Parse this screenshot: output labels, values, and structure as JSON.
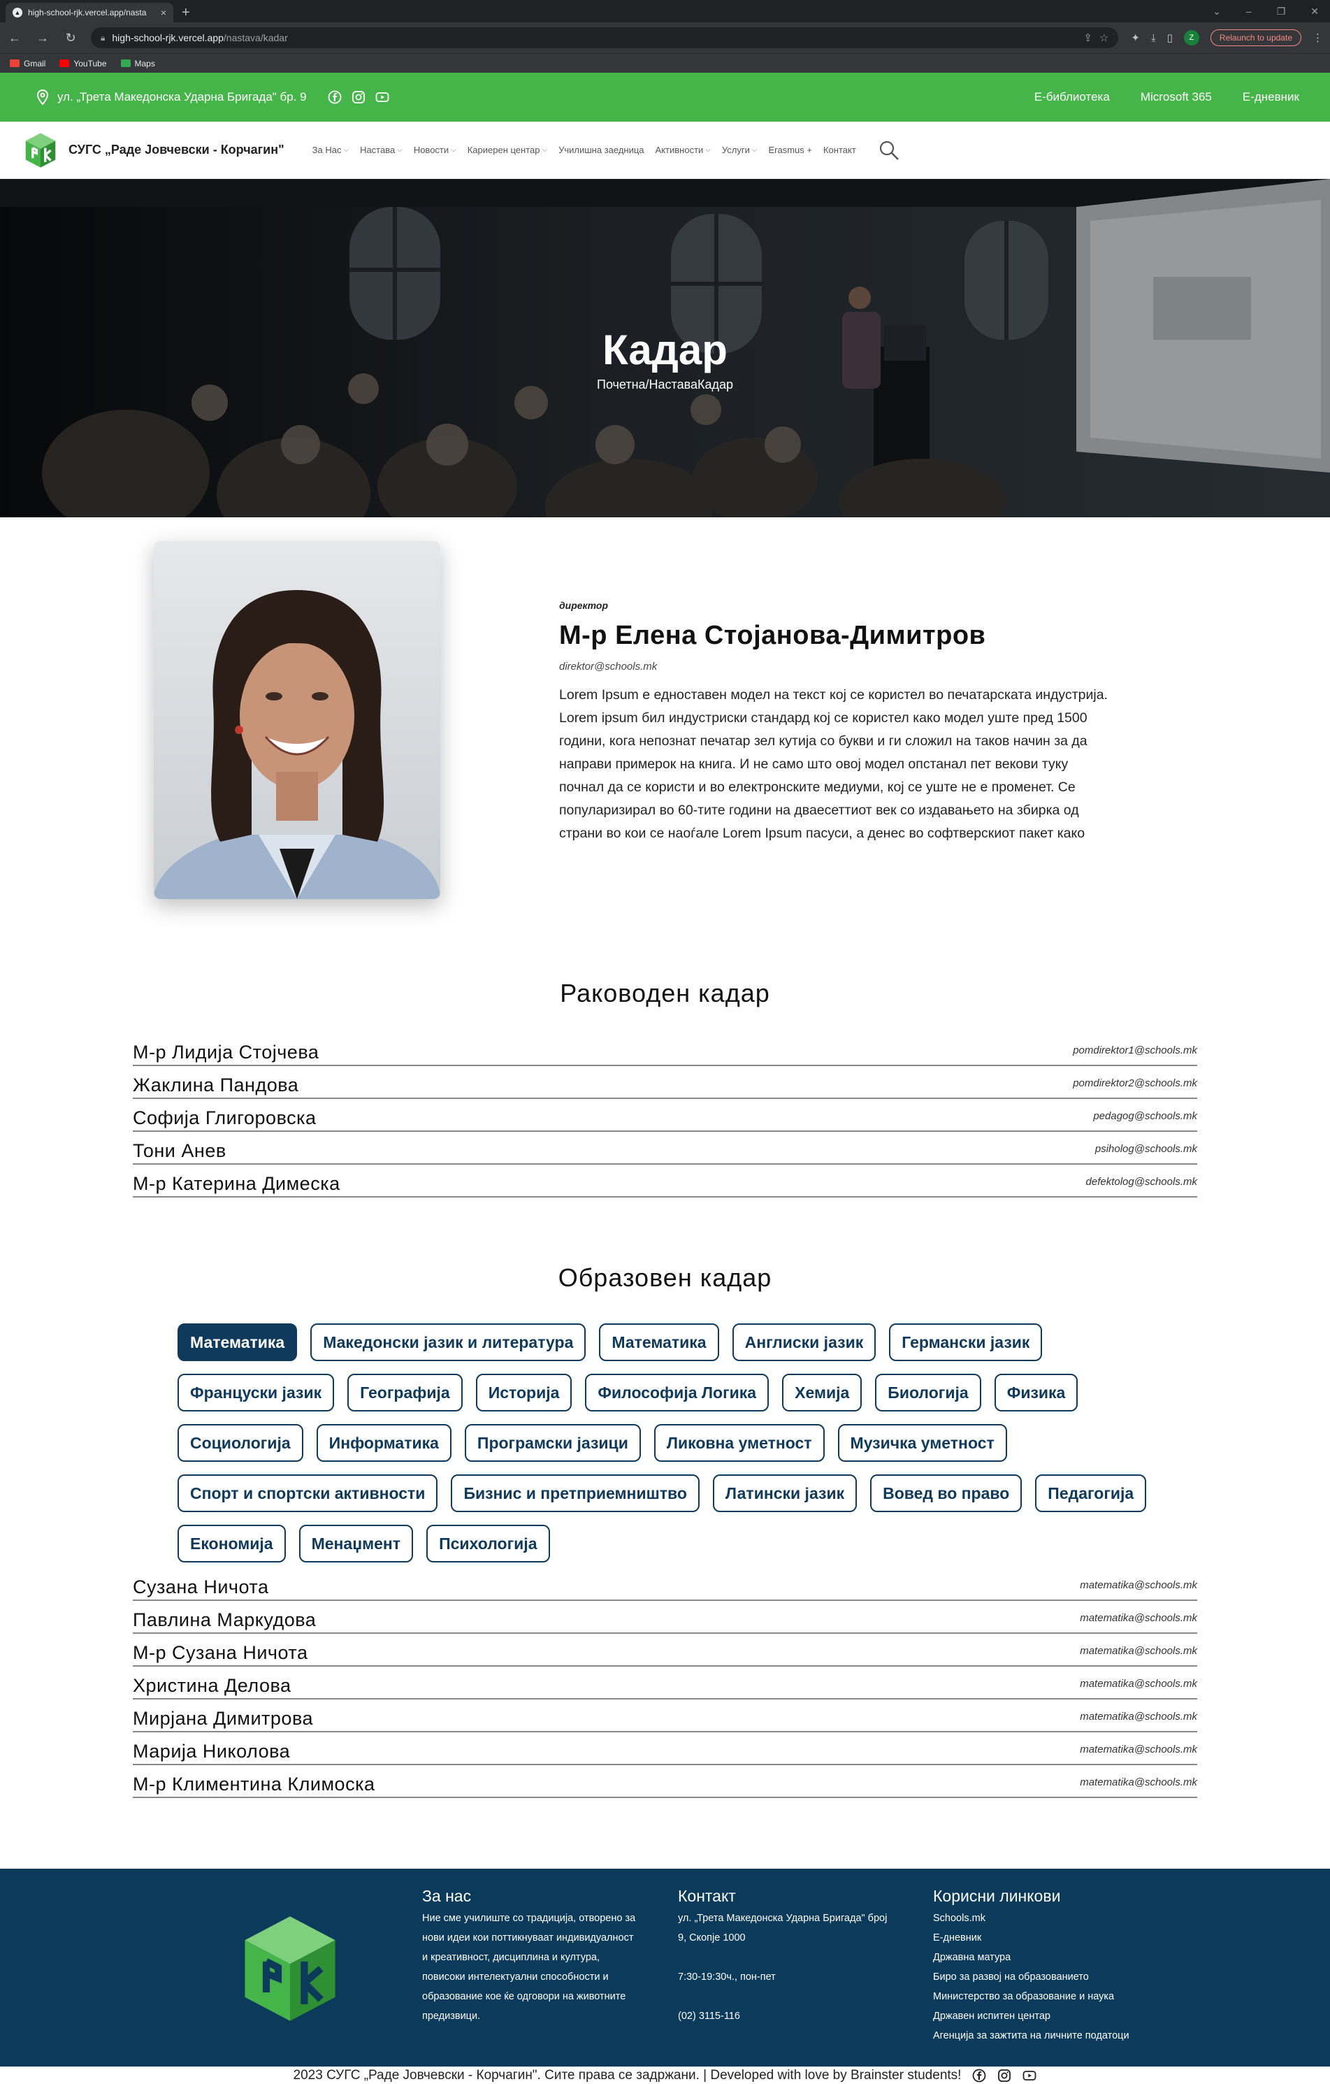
{
  "browser": {
    "tab_title": "high-school-rjk.vercel.app/nasta",
    "url_host": "high-school-rjk.vercel.app",
    "url_path": "/nastava/kadar",
    "profile_initial": "Z",
    "relaunch_label": "Relaunch to update",
    "bookmarks": [
      {
        "label": "Gmail",
        "color": "#ea4335"
      },
      {
        "label": "YouTube",
        "color": "#ff0000"
      },
      {
        "label": "Maps",
        "color": "#34a853"
      }
    ]
  },
  "topbar": {
    "address": "ул. „Трета Македонска Ударна Бригада\" бр. 9",
    "links": [
      "Е-библиотека",
      "Microsoft 365",
      "Е-дневник"
    ]
  },
  "nav": {
    "brand": "СУГС „Раде Јовчевски - Корчагин\"",
    "items": [
      {
        "label": "За Нас",
        "dropdown": true
      },
      {
        "label": "Настава",
        "dropdown": true
      },
      {
        "label": "Новости",
        "dropdown": true
      },
      {
        "label": "Кариерен центар",
        "dropdown": true
      },
      {
        "label": "Училишна заедница",
        "dropdown": false
      },
      {
        "label": "Активности",
        "dropdown": true
      },
      {
        "label": "Услуги",
        "dropdown": true
      },
      {
        "label": "Erasmus +",
        "dropdown": false
      },
      {
        "label": "Контакт",
        "dropdown": false
      }
    ]
  },
  "hero": {
    "title": "Кадар",
    "breadcrumb": "Почетна/НаставаКадар"
  },
  "director": {
    "role": "директор",
    "name": "М-р Елена Стојанова-Димитров",
    "email": "direktor@schools.mk",
    "bio_lines": [
      "Lorem Ipsum е едноставен модел на текст кој се користел во печатарската индустрија.",
      "Lorem ipsum бил индустриски стандард кој се користел како модел уште пред 1500",
      "години, кога непознат печатар зел кутија со букви и ги сложил на таков начин за да",
      "направи примерок на книга. И не само што овој модел опстанал пет векови туку",
      "почнал да се користи и во електронските медиуми, кој се уште не е променет. Се",
      "популаризирал во 60-тите години на дваесеттиот век со издавањето на збирка од",
      "страни во кои се наоѓале Lorem Ipsum пасуси, а денес во софтверскиот пакет како"
    ]
  },
  "management": {
    "title": "Раководен кадар",
    "staff": [
      {
        "name": "М-р Лидија Стојчева",
        "email": "pomdirektor1@schools.mk"
      },
      {
        "name": "Жаклина Пандова",
        "email": "pomdirektor2@schools.mk"
      },
      {
        "name": "Софија Глигоровска",
        "email": "pedagog@schools.mk"
      },
      {
        "name": "Тони Анев",
        "email": "psiholog@schools.mk"
      },
      {
        "name": "М-р Катерина Димеска",
        "email": "defektolog@schools.mk"
      }
    ]
  },
  "education": {
    "title": "Образовен кадар",
    "active_subject": "Математика",
    "subjects": [
      "Математика",
      "Македонски јазик и литература",
      "Математика",
      "Англиски јазик",
      "Германски јазик",
      "Француски јазик",
      "Географија",
      "Историја",
      "Философија Логика",
      "Хемија",
      "Биологија",
      "Физика",
      "Социологија",
      "Информатика",
      "Програмски јазици",
      "Ликовна уметност",
      "Музичка уметност",
      "Спорт и спортски активности",
      "Бизнис и претприемништво",
      "Латински јазик",
      "Вовед во право",
      "Педагогија",
      "Економија",
      "Менаџмент",
      "Психологија"
    ],
    "staff": [
      {
        "name": "Сузана Ничота",
        "email": "matematika@schools.mk"
      },
      {
        "name": "Павлина Маркудова",
        "email": "matematika@schools.mk"
      },
      {
        "name": "М-р Сузана Ничота",
        "email": "matematika@schools.mk"
      },
      {
        "name": "Христина Делова",
        "email": "matematika@schools.mk"
      },
      {
        "name": "Мирјана Димитрова",
        "email": "matematika@schools.mk"
      },
      {
        "name": "Марија Николова",
        "email": "matematika@schools.mk"
      },
      {
        "name": "М-р Климентина Климоска",
        "email": "matematika@schools.mk"
      }
    ]
  },
  "footer": {
    "about": {
      "title": "За нас",
      "lines": [
        "Ние сме училиште со традиција, отворено за",
        "нови идеи кои поттикнуваат индивидуалност",
        "и креативност, дисциплина и култура,",
        "повисоки интелектуални способности и",
        "образование кое ќе одговори на животните",
        "предизвици."
      ]
    },
    "contact": {
      "title": "Контакт",
      "address_lines": [
        "ул. „Трета Македонска Ударна Бригада\" број",
        "9, Скопје 1000"
      ],
      "hours": "7:30-19:30ч., пон-пет",
      "phone": "(02) 3115-116"
    },
    "links": {
      "title": "Корисни линкови",
      "items": [
        "Schools.mk",
        "Е-дневник",
        "Државна матура",
        "Биро за развој на образованието",
        "Министерство за образование и наука",
        "Државен испитен центар",
        "Агенција за зажтита на личните податоци"
      ]
    },
    "copyright": "2023 СУГС „Раде Јовчевски - Корчагин\". Сите права се задржани. | Developed with love by Brainster students!"
  },
  "colors": {
    "green": "#46b549",
    "navy": "#0f3a5c",
    "footer_bg": "#0b3a5a"
  }
}
